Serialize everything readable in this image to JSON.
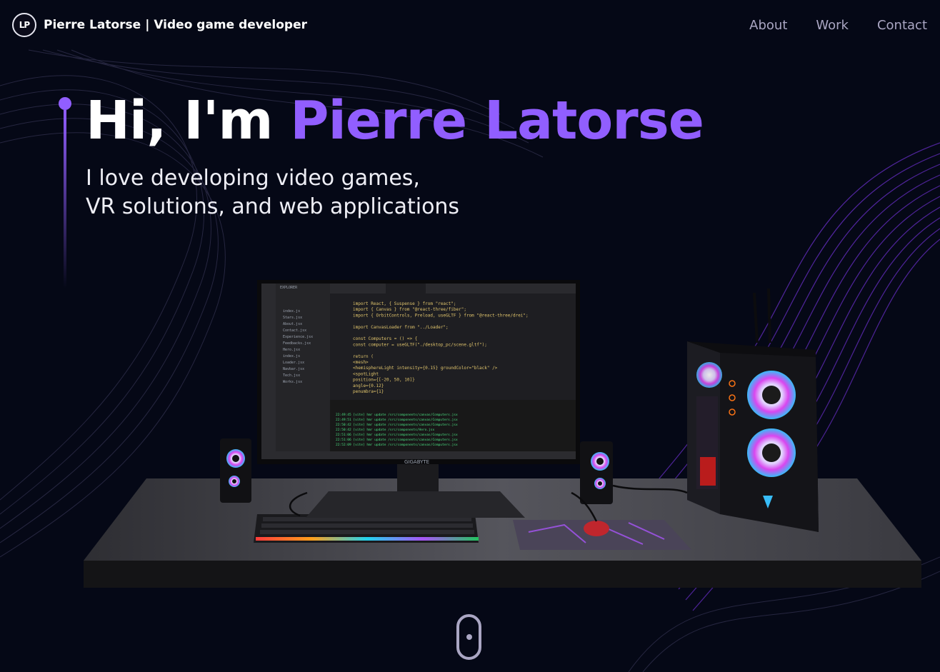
{
  "nav": {
    "logo_text": "LP",
    "name": "Pierre Latorse",
    "tagline": "| Video game developer",
    "links": [
      {
        "label": "About"
      },
      {
        "label": "Work"
      },
      {
        "label": "Contact"
      }
    ]
  },
  "hero": {
    "greeting": "Hi, I'm",
    "name": "Pierre Latorse",
    "subtitle_line1": "I love developing video games,",
    "subtitle_line2": "VR solutions, and web applications"
  },
  "scene": {
    "monitor_brand": "GIGABYTE",
    "code_lines": [
      "import React, { Suspense } from \"react\";",
      "import { Canvas } from \"@react-three/fiber\";",
      "import { OrbitControls, Preload, useGLTF } from \"@react-three/drei\";",
      "",
      "import CanvasLoader from \"../Loader\";",
      "",
      "const Computers = () => {",
      "  const computer = useGLTF(\"./desktop_pc/scene.gltf\");",
      "",
      "  return (",
      "    <mesh>",
      "      <hemisphereLight intensity={0.15} groundColor=\"black\" />",
      "      <spotLight",
      "        position={[-20, 50, 10]}",
      "        angle={0.12}",
      "        penumbra={1}"
    ]
  },
  "colors": {
    "background": "#050816",
    "accent": "#915eff",
    "nav_text": "#aaa6c3"
  }
}
